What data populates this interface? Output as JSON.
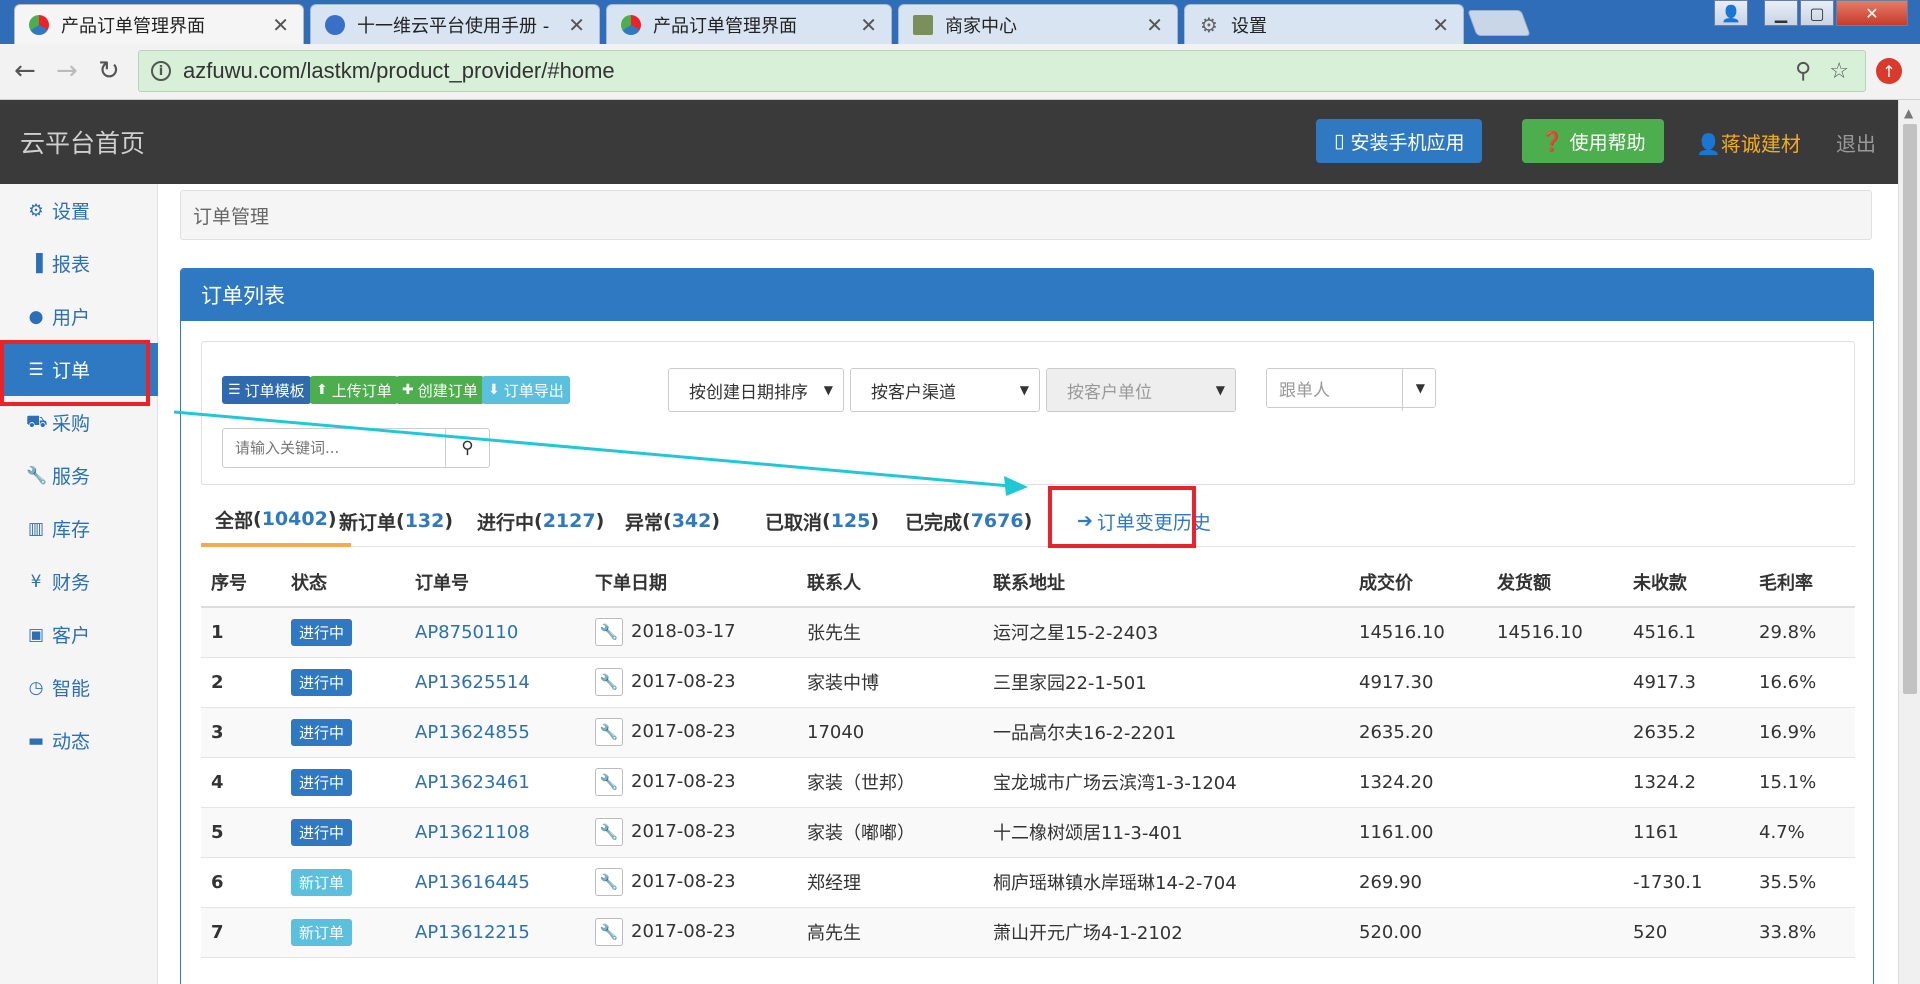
{
  "browser": {
    "tabs": [
      {
        "title": "产品订单管理界面",
        "active": true
      },
      {
        "title": "十一维云平台使用手册 -",
        "active": false
      },
      {
        "title": "产品订单管理界面",
        "active": false
      },
      {
        "title": "商家中心",
        "active": false
      },
      {
        "title": "设置",
        "active": false
      }
    ],
    "url": "azfuwu.com/lastkm/product_provider/#home"
  },
  "header": {
    "brand": "云平台首页",
    "install_app": "安装手机应用",
    "help": "使用帮助",
    "user": "蒋诚建材",
    "logout": "退出"
  },
  "sidebar": {
    "items": [
      {
        "label": "设置",
        "icon": "gear-icon"
      },
      {
        "label": "报表",
        "icon": "bar-chart-icon"
      },
      {
        "label": "用户",
        "icon": "user-icon"
      },
      {
        "label": "订单",
        "icon": "list-icon"
      },
      {
        "label": "采购",
        "icon": "cart-icon"
      },
      {
        "label": "服务",
        "icon": "wrench-icon"
      },
      {
        "label": "库存",
        "icon": "barcode-icon"
      },
      {
        "label": "财务",
        "icon": "yen-icon"
      },
      {
        "label": "客户",
        "icon": "briefcase-icon"
      },
      {
        "label": "智能",
        "icon": "dashboard-icon"
      },
      {
        "label": "动态",
        "icon": "comment-icon"
      }
    ],
    "active": "订单"
  },
  "breadcrumb": "订单管理",
  "panel": {
    "title": "订单列表",
    "buttons": {
      "template": "订单模板",
      "upload": "上传订单",
      "create": "创建订单",
      "export": "订单导出"
    },
    "selects": {
      "sort": "按创建日期排序",
      "channel": "按客户渠道",
      "unit": "按客户单位",
      "staff_placeholder": "跟单人"
    },
    "search_placeholder": "请输入关键词..."
  },
  "filters": {
    "all": {
      "label": "全部",
      "count": "10402"
    },
    "new": {
      "label": "新订单",
      "count": "132"
    },
    "running": {
      "label": "进行中",
      "count": "2127"
    },
    "abnormal": {
      "label": "异常",
      "count": "342"
    },
    "cancelled": {
      "label": "已取消",
      "count": "125"
    },
    "done": {
      "label": "已完成",
      "count": "7676"
    },
    "history": "订单变更历史"
  },
  "table": {
    "columns": [
      "序号",
      "状态",
      "订单号",
      "下单日期",
      "联系人",
      "联系地址",
      "成交价",
      "发货额",
      "未收款",
      "毛利率"
    ],
    "rows": [
      [
        "1",
        "进行中",
        "AP8750110",
        "2018-03-17",
        "张先生",
        "运河之星15-2-2403",
        "14516.10",
        "14516.10",
        "4516.1",
        "29.8%"
      ],
      [
        "2",
        "进行中",
        "AP13625514",
        "2017-08-23",
        "家装中博",
        "三里家园22-1-501",
        "4917.30",
        "",
        "4917.3",
        "16.6%"
      ],
      [
        "3",
        "进行中",
        "AP13624855",
        "2017-08-23",
        "17040",
        "一品高尔夫16-2-2201",
        "2635.20",
        "",
        "2635.2",
        "16.9%"
      ],
      [
        "4",
        "进行中",
        "AP13623461",
        "2017-08-23",
        "家装（世邦）",
        "宝龙城市广场云滨湾1-3-1204",
        "1324.20",
        "",
        "1324.2",
        "15.1%"
      ],
      [
        "5",
        "进行中",
        "AP13621108",
        "2017-08-23",
        "家装（嘟嘟）",
        "十二橡树颂居11-3-401",
        "1161.00",
        "",
        "1161",
        "4.7%"
      ],
      [
        "6",
        "新订单",
        "AP13616445",
        "2017-08-23",
        "郑经理",
        "桐庐瑶琳镇水岸瑶琳14-2-704",
        "269.90",
        "",
        "-1730.1",
        "35.5%"
      ],
      [
        "7",
        "新订单",
        "AP13612215",
        "2017-08-23",
        "高先生",
        "萧山开元广场4-1-2102",
        "520.00",
        "",
        "520",
        "33.8%"
      ]
    ]
  },
  "colors": {
    "primary": "#2e79c2",
    "success": "#4cae4c",
    "info": "#5bc0de",
    "highlight_red": "#e8242a",
    "arrow_cyan": "#1fc8d6"
  }
}
